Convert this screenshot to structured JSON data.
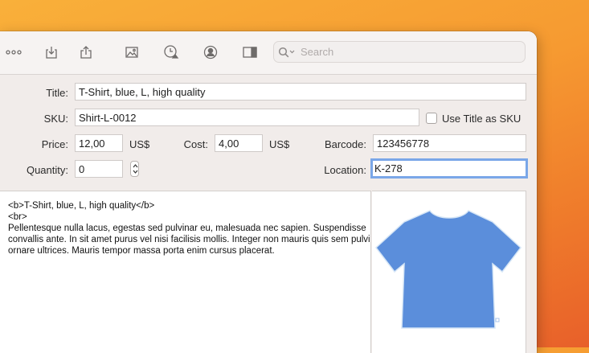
{
  "toolbar": {
    "icons": [
      "more-icon",
      "import-icon",
      "share-icon",
      "image-icon",
      "history-icon",
      "account-icon",
      "sidebar-toggle-icon"
    ],
    "search": {
      "placeholder": "Search",
      "value": ""
    }
  },
  "form": {
    "title_label": "Title:",
    "title_value": "T-Shirt, blue, L, high quality",
    "sku_label": "SKU:",
    "sku_value": "Shirt-L-0012",
    "use_title_as_sku_label": "Use Title as SKU",
    "use_title_as_sku_checked": false,
    "price_label": "Price:",
    "price_value": "12,00",
    "price_currency": "US$",
    "cost_label": "Cost:",
    "cost_value": "4,00",
    "cost_currency": "US$",
    "barcode_label": "Barcode:",
    "barcode_value": "123456778",
    "quantity_label": "Quantity:",
    "quantity_value": "0",
    "location_label": "Location:",
    "location_value": "K-278"
  },
  "description": {
    "lines": [
      "<b>T-Shirt, blue, L, high quality</b>",
      "<br>",
      "Pellentesque nulla lacus, egestas sed pulvinar eu, malesuada nec sapien. Suspendisse",
      "convallis ante. In sit amet purus vel nisi facilisis mollis. Integer non mauris quis sem pulvinar",
      "ornare ultrices. Mauris tempor massa porta enim cursus placerat."
    ]
  },
  "preview": {
    "image": "tshirt-image",
    "color": "#5b8edb"
  }
}
